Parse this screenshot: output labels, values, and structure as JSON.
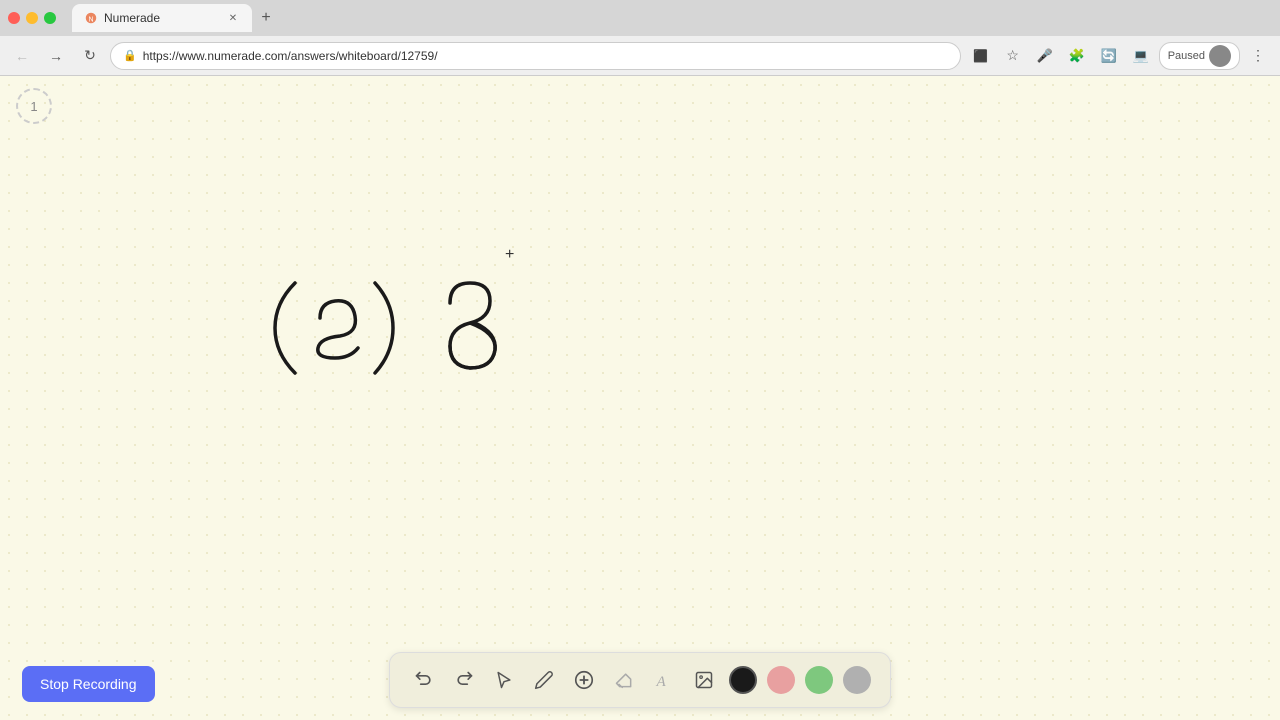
{
  "browser": {
    "title": "Numerade",
    "url": "https://www.numerade.com/answers/whiteboard/12759/",
    "tab_label": "Numerade",
    "paused_label": "Paused"
  },
  "page_number": "1",
  "cursor_symbol": "+",
  "stop_recording_label": "Stop Recording",
  "toolbar": {
    "undo_label": "↺",
    "redo_label": "↻",
    "select_icon": "select",
    "pen_icon": "pen",
    "add_icon": "+",
    "eraser_icon": "eraser",
    "text_icon": "A",
    "image_icon": "image",
    "colors": [
      {
        "name": "black",
        "hex": "#1a1a1a"
      },
      {
        "name": "pink",
        "hex": "#e8a0a0"
      },
      {
        "name": "green",
        "hex": "#7ec87e"
      },
      {
        "name": "gray",
        "hex": "#b0b0b0"
      }
    ]
  }
}
